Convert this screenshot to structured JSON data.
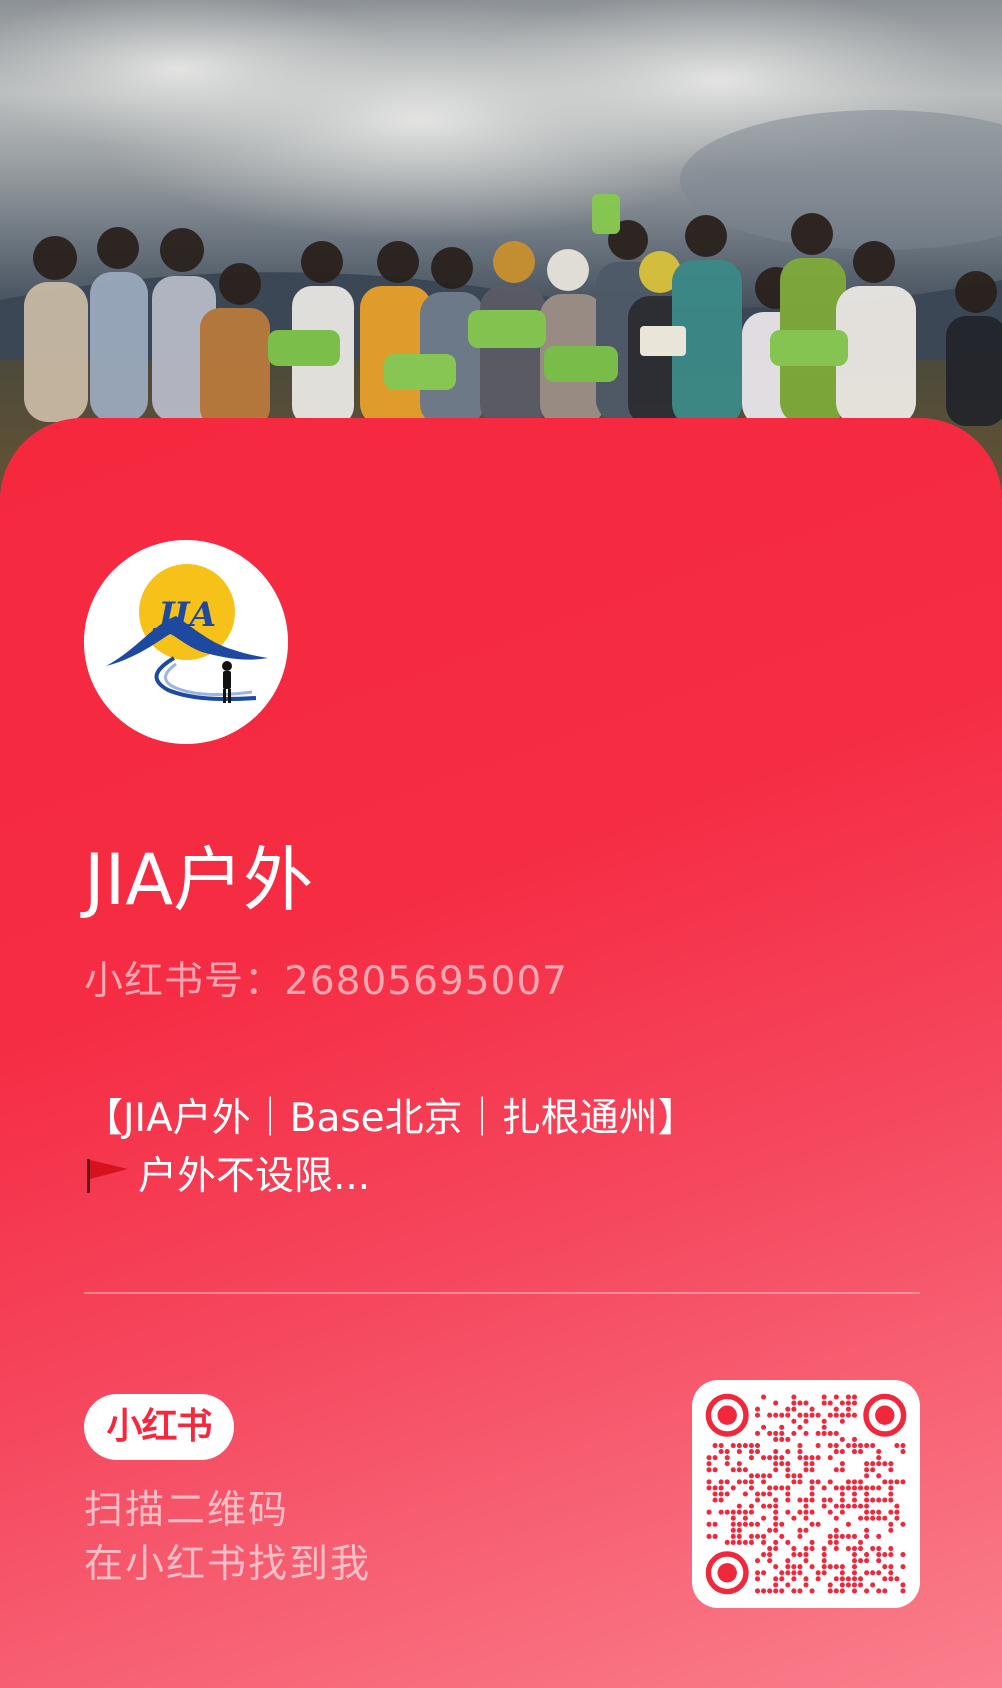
{
  "profile": {
    "name": "JIA户外",
    "account_label": "小红书号：",
    "account_id": "26805695007",
    "bio_line1": "【JIA户外｜Base北京｜扎根通州】",
    "bio_line2": "户外不设限..."
  },
  "logo": {
    "text": "JIA",
    "icon": "jia-outdoor-logo-icon"
  },
  "footer": {
    "brand_badge": "小红书",
    "scan_line1": "扫描二维码",
    "scan_line2": "在小红书找到我"
  },
  "icons": {
    "bio_flag": "red-flag-icon",
    "qr": "qr-code-icon"
  },
  "colors": {
    "card_red": "#f5283e",
    "card_pink": "#fa7f8d",
    "qr_red": "#f0283c"
  }
}
